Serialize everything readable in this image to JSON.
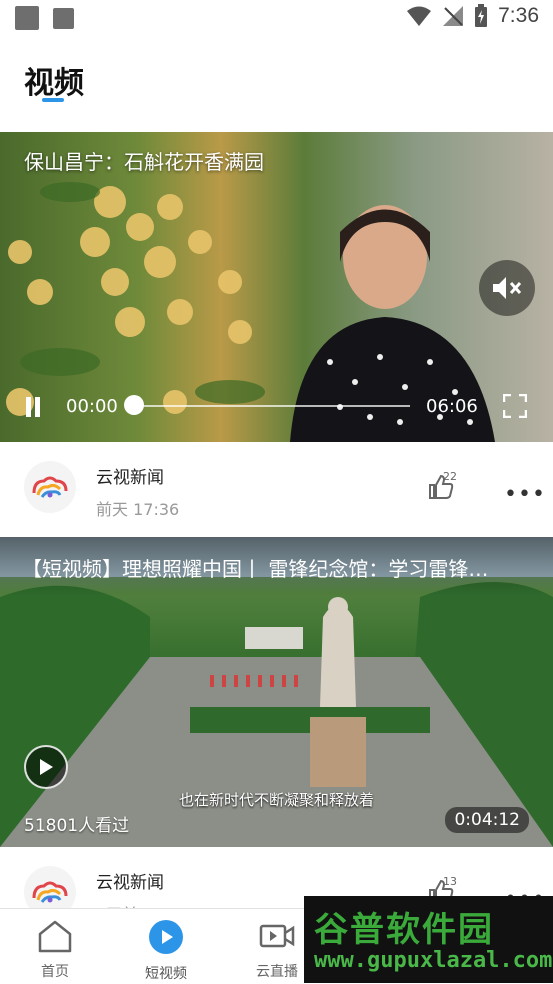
{
  "status_bar": {
    "time": "7:36"
  },
  "header": {
    "title": "视频"
  },
  "videos": [
    {
      "title": "保山昌宁：石斛花开香满园",
      "current_time": "00:00",
      "total_time": "06:06",
      "author": "云视新闻",
      "time_ago": "前天 17:36",
      "likes": "22"
    },
    {
      "title": "【短视频】理想照耀中国丨 雷锋纪念馆：学习雷锋…",
      "subtitle": "也在新时代不断凝聚和释放着",
      "views": "51801人看过",
      "duration": "0:04:12",
      "author": "云视新闻",
      "time_ago": "4天前",
      "likes": "13"
    }
  ],
  "nav": {
    "home": "首页",
    "short_video": "短视频",
    "live": "云直播"
  },
  "watermark": {
    "title": "谷普软件园",
    "url": "www.gupuxlazal.com"
  },
  "colors": {
    "accent": "#2d95e8",
    "text": "#222222",
    "muted": "#999999"
  }
}
